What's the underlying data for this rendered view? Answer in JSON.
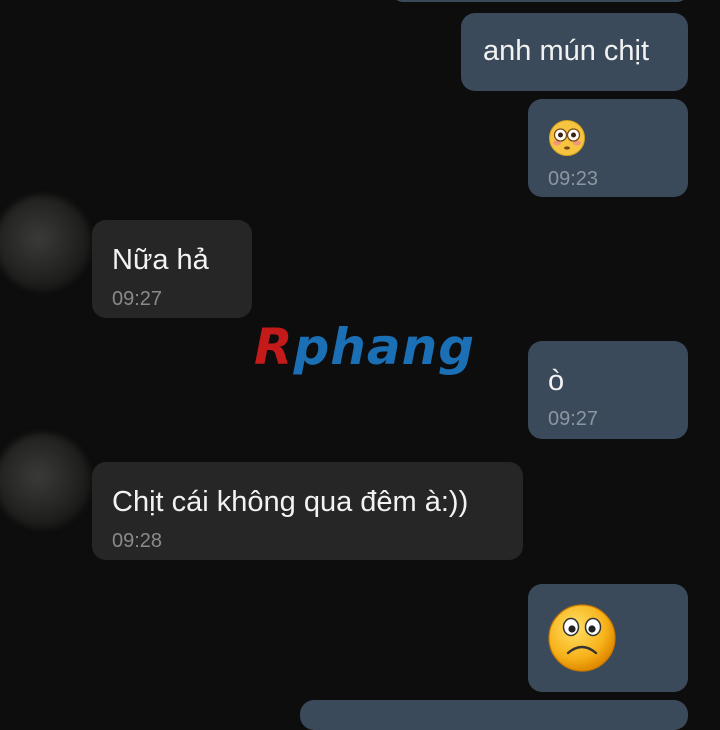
{
  "watermark": {
    "first": "R",
    "rest": "phang"
  },
  "messages": [
    {
      "text": "anh mún chịt"
    },
    {
      "emoji": "flushed-face-emoji",
      "time": "09:23"
    },
    {
      "text": "Nữa hả",
      "time": "09:27"
    },
    {
      "text": "ò",
      "time": "09:27"
    },
    {
      "text": "Chịt cái không qua đêm à:))",
      "time": "09:28"
    },
    {
      "emoji": "sad-face-emoji"
    }
  ]
}
